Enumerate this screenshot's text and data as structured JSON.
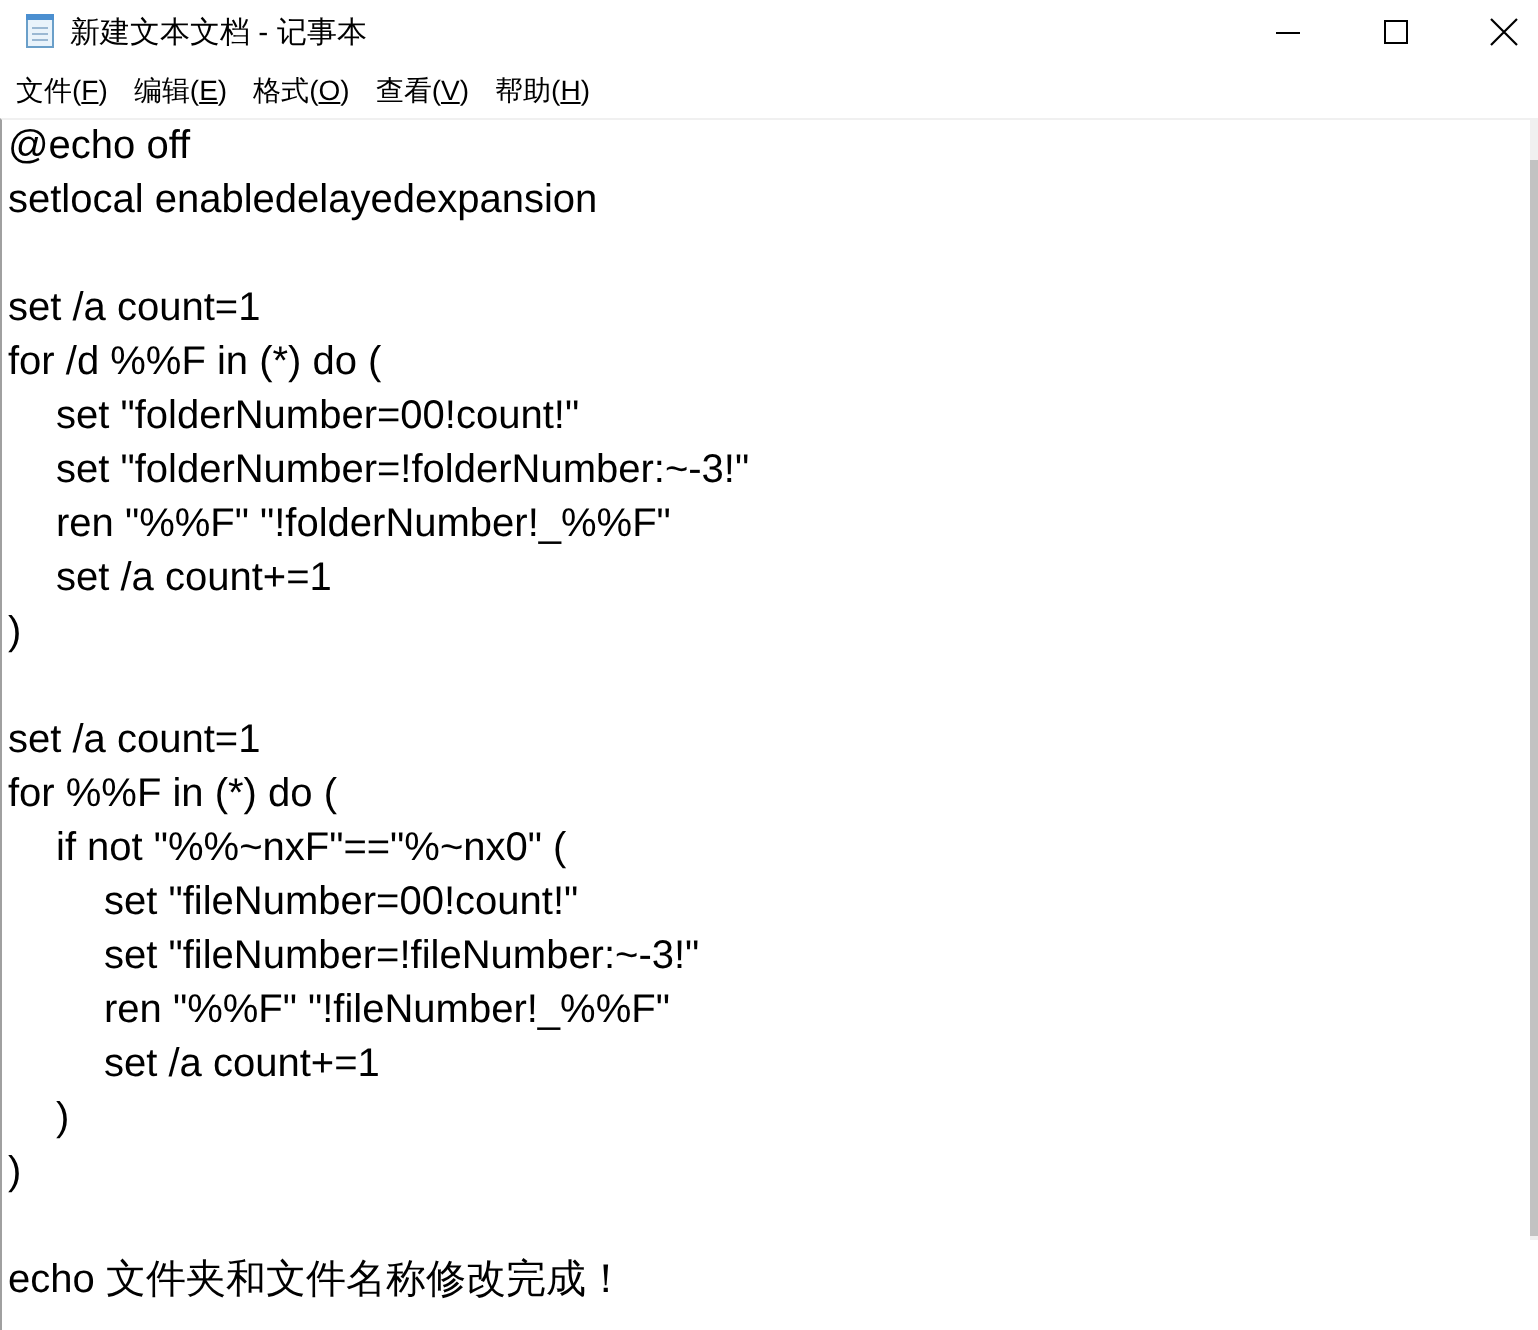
{
  "window": {
    "title": "新建文本文档 - 记事本"
  },
  "menu_bar": [
    {
      "label_start": "文件(",
      "access_key": "F",
      "label_end": ")"
    },
    {
      "label_start": "编辑(",
      "access_key": "E",
      "label_end": ")"
    },
    {
      "label_start": "格式(",
      "access_key": "O",
      "label_end": ")"
    },
    {
      "label_start": "查看(",
      "access_key": "V",
      "label_end": ")"
    },
    {
      "label_start": "帮助(",
      "access_key": "H",
      "label_end": ")"
    }
  ],
  "editor": {
    "blocks": [
      {
        "lines": [
          {
            "text": "@echo off"
          },
          {
            "text": "setlocal enabledelayedexpansion"
          }
        ]
      },
      {
        "lines": [
          {
            "text": "set /a count=1"
          },
          {
            "text": "for /d %%F in (*) do (",
            "children": [
              {
                "text": "set \"folderNumber=00!count!\""
              },
              {
                "text": "set \"folderNumber=!folderNumber:~-3!\""
              },
              {
                "text": "ren \"%%F\" \"!folderNumber!_%%F\""
              },
              {
                "text": "set /a count+=1"
              }
            ]
          },
          {
            "text": ")"
          }
        ]
      },
      {
        "lines": [
          {
            "text": "set /a count=1"
          },
          {
            "text": "for %%F in (*) do (",
            "children": [
              {
                "text": "if not \"%%~nxF\"==\"%~nx0\" (",
                "children": [
                  {
                    "text": "set \"fileNumber=00!count!\""
                  },
                  {
                    "text": "set \"fileNumber=!fileNumber:~-3!\""
                  },
                  {
                    "text": "ren \"%%F\" \"!fileNumber!_%%F\""
                  },
                  {
                    "text": "set /a count+=1"
                  }
                ]
              },
              {
                "text": ")"
              }
            ]
          },
          {
            "text": ")"
          }
        ]
      },
      {
        "lines": [
          {
            "text": "echo 文件夹和文件名称修改完成！"
          }
        ]
      }
    ]
  }
}
